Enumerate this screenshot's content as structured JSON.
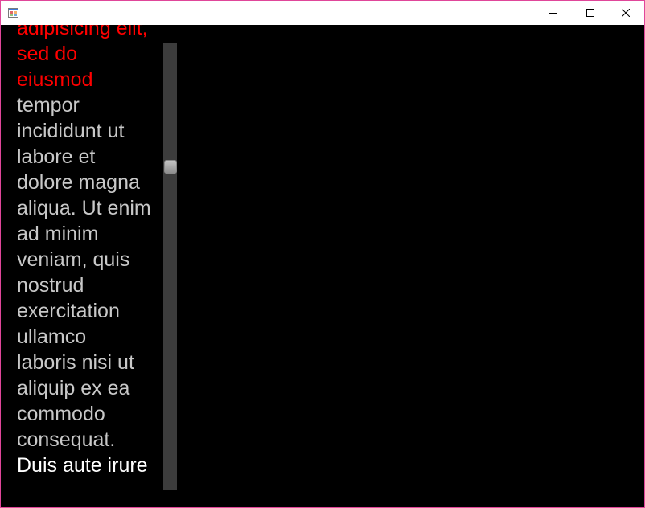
{
  "window": {
    "title": "",
    "border_color": "#e0469a",
    "icons": {
      "app": "app-icon",
      "minimize": "minimize-icon",
      "maximize": "maximize-icon",
      "close": "close-icon"
    }
  },
  "text_block": {
    "red_color": "#ff0000",
    "gray_color": "#c8c8c8",
    "white_color": "#ffffff",
    "lines": [
      "adipisicing elit,",
      "sed do",
      "eiusmod",
      "tempor",
      "incididunt ut",
      "labore et",
      "dolore magna",
      "aliqua. Ut enim",
      "ad minim",
      "veniam, quis",
      "nostrud",
      "exercitation",
      "ullamco",
      "laboris nisi ut",
      "aliquip ex ea",
      "commodo",
      "consequat.",
      "Duis aute irure"
    ]
  },
  "scrollbar": {
    "orientation": "vertical",
    "value_fraction": 0.27
  }
}
